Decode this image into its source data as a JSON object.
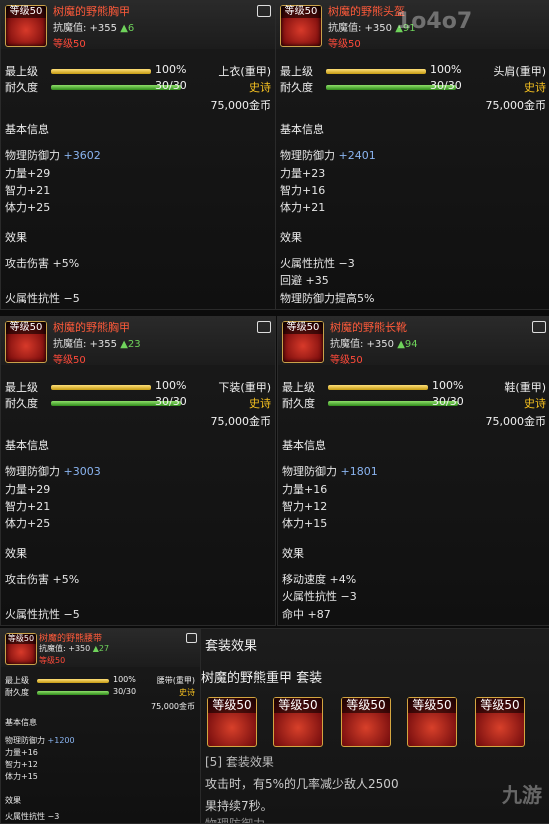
{
  "panels": [
    {
      "level_badge": "等级50",
      "name": "树魔的野熊胸甲",
      "resist_label": "抗魔值: +355",
      "resist_up": "▲6",
      "req_level": "等级50",
      "max_label": "最上级",
      "max_pct": "100%",
      "dur_label": "耐久度",
      "dur_value": "30/30",
      "slot": "上衣(重甲)",
      "rarity": "史诗",
      "price": "75,000金币",
      "basic_title": "基本信息",
      "basic": [
        {
          "name": "物理防御力",
          "val": "+3602"
        },
        {
          "name": "力量+29",
          "val": ""
        },
        {
          "name": "智力+21",
          "val": ""
        },
        {
          "name": "体力+25",
          "val": ""
        }
      ],
      "effect_title": "效果",
      "effects": [
        "攻击伤害 +5%",
        "",
        "火属性抗性 −5"
      ]
    },
    {
      "level_badge": "等级50",
      "name": "树魔的野熊头盔",
      "resist_label": "抗魔值: +350",
      "resist_up": "▲91",
      "req_level": "等级50",
      "max_label": "最上级",
      "max_pct": "100%",
      "dur_label": "耐久度",
      "dur_value": "30/30",
      "slot": "头肩(重甲)",
      "rarity": "史诗",
      "price": "75,000金币",
      "basic_title": "基本信息",
      "basic": [
        {
          "name": "物理防御力",
          "val": "+2401"
        },
        {
          "name": "力量+23",
          "val": ""
        },
        {
          "name": "智力+16",
          "val": ""
        },
        {
          "name": "体力+21",
          "val": ""
        }
      ],
      "effect_title": "效果",
      "effects": [
        "火属性抗性 −3",
        "回避 +35",
        "物理防御力提高5%"
      ]
    },
    {
      "level_badge": "等级50",
      "name": "树魔的野熊胸甲",
      "resist_label": "抗魔值: +355",
      "resist_up": "▲23",
      "req_level": "等级50",
      "max_label": "最上级",
      "max_pct": "100%",
      "dur_label": "耐久度",
      "dur_value": "30/30",
      "slot": "下装(重甲)",
      "rarity": "史诗",
      "price": "75,000金币",
      "basic_title": "基本信息",
      "basic": [
        {
          "name": "物理防御力",
          "val": "+3003"
        },
        {
          "name": "力量+29",
          "val": ""
        },
        {
          "name": "智力+21",
          "val": ""
        },
        {
          "name": "体力+25",
          "val": ""
        }
      ],
      "effect_title": "效果",
      "effects": [
        "攻击伤害 +5%",
        "",
        "火属性抗性 −5"
      ]
    },
    {
      "level_badge": "等级50",
      "name": "树魔的野熊长靴",
      "resist_label": "抗魔值: +350",
      "resist_up": "▲94",
      "req_level": "等级50",
      "max_label": "最上级",
      "max_pct": "100%",
      "dur_label": "耐久度",
      "dur_value": "30/30",
      "slot": "鞋(重甲)",
      "rarity": "史诗",
      "price": "75,000金币",
      "basic_title": "基本信息",
      "basic": [
        {
          "name": "物理防御力",
          "val": "+1801"
        },
        {
          "name": "力量+16",
          "val": ""
        },
        {
          "name": "智力+12",
          "val": ""
        },
        {
          "name": "体力+15",
          "val": ""
        }
      ],
      "effect_title": "效果",
      "effects": [
        "移动速度 +4%",
        "火属性抗性 −3",
        "命中 +87"
      ]
    },
    {
      "level_badge": "等级50",
      "name": "树魔的野熊腰带",
      "resist_label": "抗魔值: +350",
      "resist_up": "▲27",
      "req_level": "等级50",
      "max_label": "最上级",
      "max_pct": "100%",
      "dur_label": "耐久度",
      "dur_value": "30/30",
      "slot": "腰带(重甲)",
      "rarity": "史诗",
      "price": "75,000金币",
      "basic_title": "基本信息",
      "basic": [
        {
          "name": "物理防御力",
          "val": "+1200"
        },
        {
          "name": "力量+16",
          "val": ""
        },
        {
          "name": "智力+12",
          "val": ""
        },
        {
          "name": "体力+15",
          "val": ""
        }
      ],
      "effect_title": "效果",
      "effects": [
        "火属性抗性 −3"
      ]
    }
  ],
  "set": {
    "header": "套装效果",
    "name": "树魔的野熊重甲  套装",
    "icons": [
      "等级50",
      "等级50",
      "等级50",
      "等级50",
      "等级50"
    ],
    "effect_title": "[5] 套装效果",
    "effect_line1": "攻击时，有5%的几率减少敌人2500",
    "effect_line2": "果持续7秒。",
    "effect_line3": "物理防御力..."
  },
  "watermark": "1o4o7",
  "watermark2": "九游"
}
